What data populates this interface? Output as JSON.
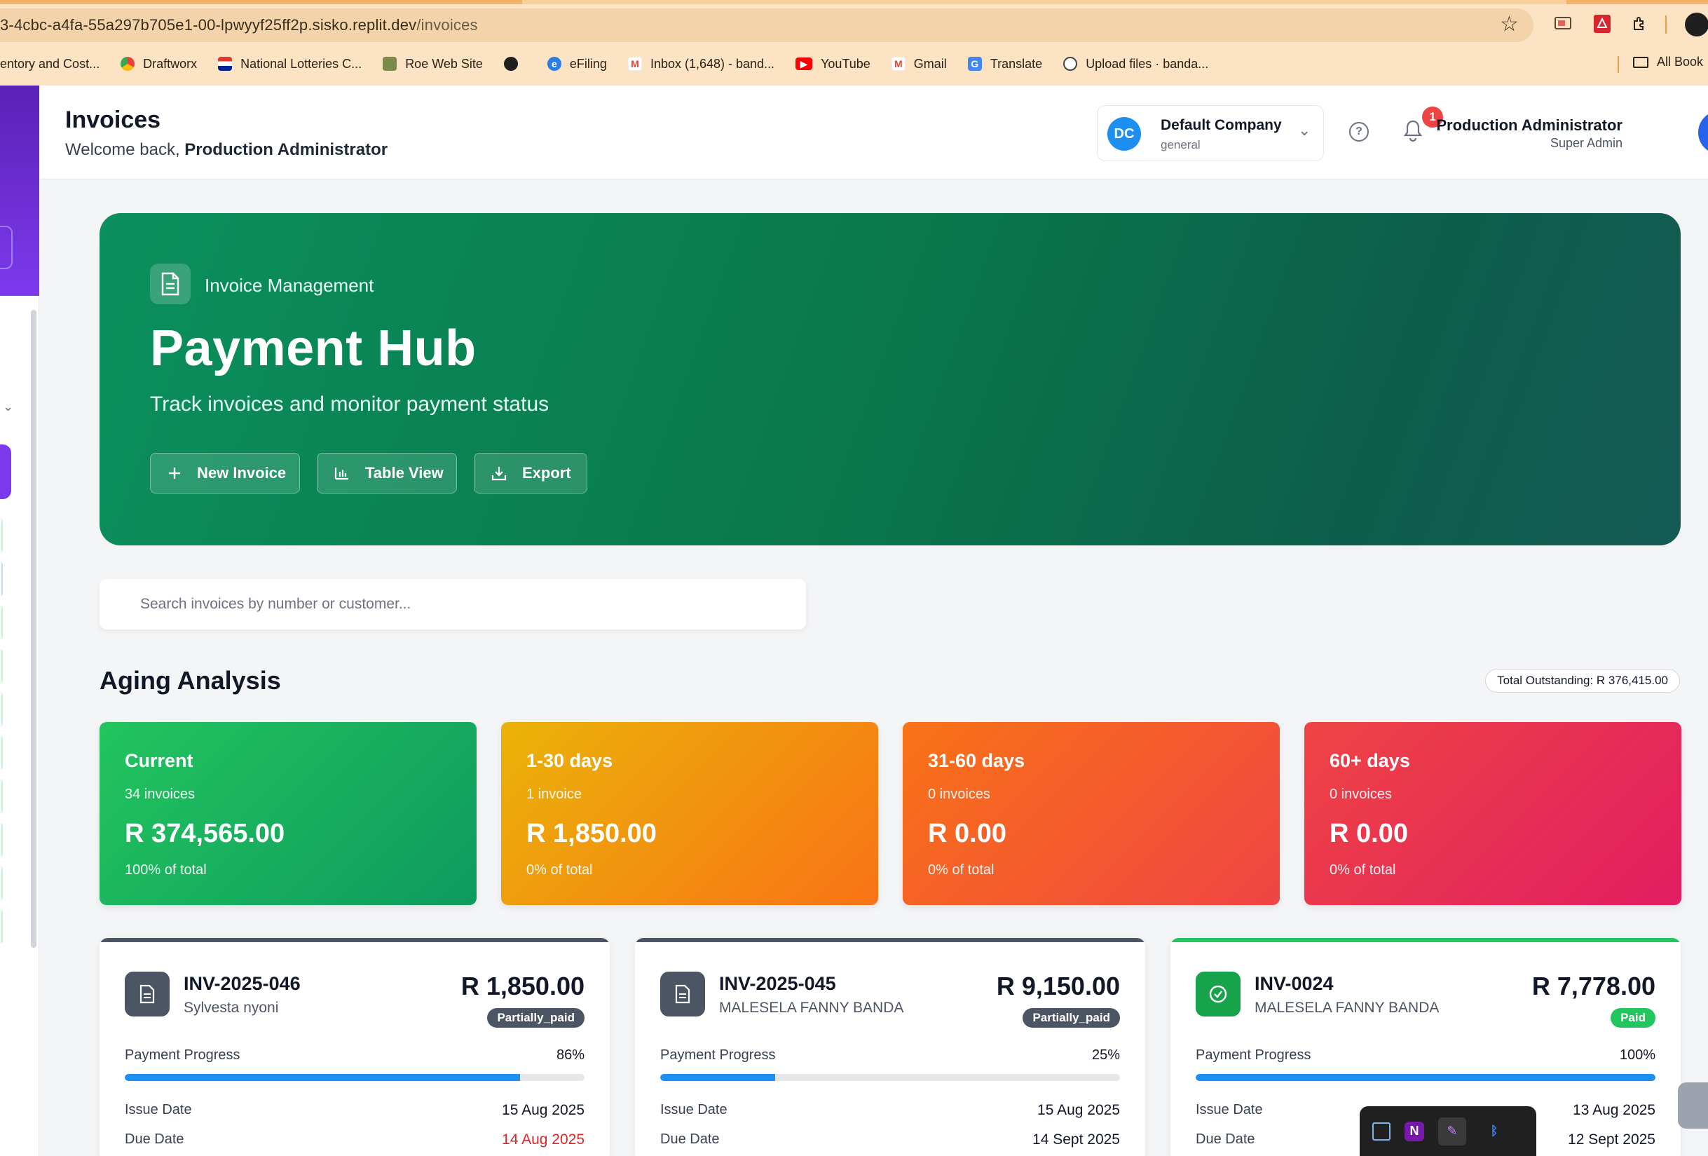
{
  "browser": {
    "url_host": "3-4cbc-a4fa-55a297b705e1-00-lpwyyf25ff2p.sisko.replit.dev",
    "url_path": "/invoices",
    "bookmarks": [
      {
        "label": "entory and Cost...",
        "icon": "blank"
      },
      {
        "label": "Draftworx",
        "icon": "chrome-icon"
      },
      {
        "label": "National Lotteries C...",
        "icon": "flag-icon"
      },
      {
        "label": "Roe Web Site",
        "icon": "image-icon"
      },
      {
        "label": "",
        "icon": "globe-icon"
      },
      {
        "label": "eFiling",
        "icon": "efiling-icon"
      },
      {
        "label": "Inbox (1,648) - band...",
        "icon": "gmail-icon"
      },
      {
        "label": "YouTube",
        "icon": "youtube-icon"
      },
      {
        "label": "Gmail",
        "icon": "gmail-icon"
      },
      {
        "label": "Translate",
        "icon": "translate-icon"
      },
      {
        "label": "Upload files · banda...",
        "icon": "github-icon"
      }
    ],
    "all_bookmarks": "All Book"
  },
  "header": {
    "title": "Invoices",
    "welcome_prefix": "Welcome back, ",
    "welcome_user": "Production Administrator",
    "company": {
      "initials": "DC",
      "name": "Default Company",
      "sub": "general"
    },
    "notifications": "1",
    "user": {
      "name": "Production Administrator",
      "role": "Super Admin"
    }
  },
  "hero": {
    "eyebrow": "Invoice Management",
    "title": "Payment Hub",
    "subtitle": "Track invoices and monitor payment status",
    "buttons": [
      {
        "label": "New Invoice",
        "icon": "plus-icon"
      },
      {
        "label": "Table View",
        "icon": "bar-chart-icon"
      },
      {
        "label": "Export",
        "icon": "download-icon"
      }
    ]
  },
  "search": {
    "placeholder": "Search invoices by number or customer..."
  },
  "aging": {
    "title": "Aging Analysis",
    "total_outstanding": "Total Outstanding: R 376,415.00",
    "buckets": [
      {
        "label": "Current",
        "count": "34 invoices",
        "amount": "R 374,565.00",
        "pct": "100% of total",
        "color": "#16a34a"
      },
      {
        "label": "1-30 days",
        "count": "1 invoice",
        "amount": "R 1,850.00",
        "pct": "0% of total",
        "color": "#f59e0b"
      },
      {
        "label": "31-60 days",
        "count": "0 invoices",
        "amount": "R 0.00",
        "pct": "0% of total",
        "color": "#f97316"
      },
      {
        "label": "60+ days",
        "count": "0 invoices",
        "amount": "R 0.00",
        "pct": "0% of total",
        "color": "#e11d48"
      }
    ]
  },
  "invoices": [
    {
      "number": "INV-2025-046",
      "customer": "Sylvesta nyoni",
      "amount": "R 1,850.00",
      "status": "Partially_paid",
      "progress_label": "Payment Progress",
      "progress_text": "86%",
      "progress": 0.86,
      "issue_label": "Issue Date",
      "issue_date": "15 Aug 2025",
      "due_label": "Due Date",
      "due_date": "14 Aug 2025",
      "overdue": true,
      "accent": "#4b5563",
      "icon": "document-icon"
    },
    {
      "number": "INV-2025-045",
      "customer": "MALESELA FANNY BANDA",
      "amount": "R 9,150.00",
      "status": "Partially_paid",
      "progress_label": "Payment Progress",
      "progress_text": "25%",
      "progress": 0.25,
      "issue_label": "Issue Date",
      "issue_date": "15 Aug 2025",
      "due_label": "Due Date",
      "due_date": "14 Sept 2025",
      "overdue": false,
      "accent": "#4b5563",
      "icon": "document-icon"
    },
    {
      "number": "INV-0024",
      "customer": "MALESELA FANNY BANDA",
      "amount": "R 7,778.00",
      "status": "Paid",
      "progress_label": "Payment Progress",
      "progress_text": "100%",
      "progress": 1.0,
      "issue_label": "Issue Date",
      "issue_date": "13 Aug 2025",
      "due_label": "Due Date",
      "due_date": "12 Sept 2025",
      "overdue": false,
      "accent": "#22c55e",
      "icon": "check-circle-icon"
    }
  ],
  "tray": [
    "windows-icon",
    "onenote-icon",
    "pen-icon",
    "bluetooth-icon"
  ]
}
